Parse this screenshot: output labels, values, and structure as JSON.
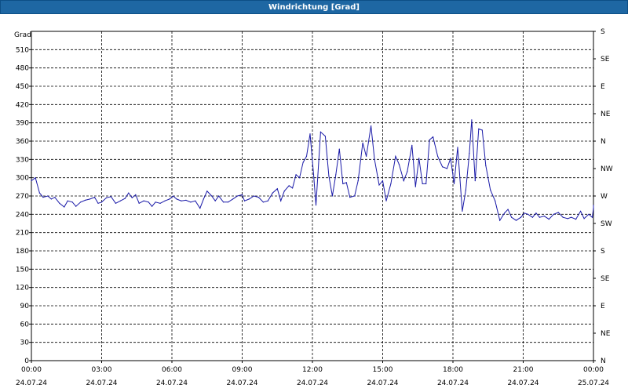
{
  "window": {
    "title": "Windrichtung [Grad]"
  },
  "chart_data": {
    "type": "line",
    "ylabel": "Grad",
    "ylim": [
      0,
      540
    ],
    "y_ticks": [
      0,
      30,
      60,
      90,
      120,
      150,
      180,
      210,
      240,
      270,
      300,
      330,
      360,
      390,
      420,
      450,
      480,
      510
    ],
    "right_axis_labels": [
      {
        "y": 0,
        "label": "N"
      },
      {
        "y": 45,
        "label": "NE"
      },
      {
        "y": 90,
        "label": "E"
      },
      {
        "y": 135,
        "label": "SE"
      },
      {
        "y": 180,
        "label": "S"
      },
      {
        "y": 225,
        "label": "SW"
      },
      {
        "y": 270,
        "label": "W"
      },
      {
        "y": 315,
        "label": "NW"
      },
      {
        "y": 360,
        "label": "N"
      },
      {
        "y": 405,
        "label": "NE"
      },
      {
        "y": 450,
        "label": "E"
      },
      {
        "y": 495,
        "label": "SE"
      },
      {
        "y": 540,
        "label": "S"
      }
    ],
    "xlim_hours": [
      0,
      24
    ],
    "x_ticks": [
      {
        "hour": 0,
        "time": "00:00",
        "date": "24.07.24"
      },
      {
        "hour": 3,
        "time": "03:00",
        "date": "24.07.24"
      },
      {
        "hour": 6,
        "time": "06:00",
        "date": "24.07.24"
      },
      {
        "hour": 9,
        "time": "09:00",
        "date": "24.07.24"
      },
      {
        "hour": 12,
        "time": "12:00",
        "date": "24.07.24"
      },
      {
        "hour": 15,
        "time": "15:00",
        "date": "24.07.24"
      },
      {
        "hour": 18,
        "time": "18:00",
        "date": "24.07.24"
      },
      {
        "hour": 21,
        "time": "21:00",
        "date": "24.07.24"
      },
      {
        "hour": 24,
        "time": "00:00",
        "date": "25.07.24"
      }
    ],
    "grid": true,
    "line_color": "#1a1aa8",
    "series": [
      {
        "points": [
          [
            0.0,
            295
          ],
          [
            0.17,
            300
          ],
          [
            0.35,
            275
          ],
          [
            0.5,
            268
          ],
          [
            0.7,
            270
          ],
          [
            0.85,
            265
          ],
          [
            1.0,
            268
          ],
          [
            1.2,
            258
          ],
          [
            1.4,
            252
          ],
          [
            1.55,
            262
          ],
          [
            1.75,
            260
          ],
          [
            1.9,
            253
          ],
          [
            2.1,
            260
          ],
          [
            2.3,
            263
          ],
          [
            2.5,
            265
          ],
          [
            2.7,
            268
          ],
          [
            2.85,
            258
          ],
          [
            3.0,
            260
          ],
          [
            3.2,
            267
          ],
          [
            3.4,
            269
          ],
          [
            3.6,
            258
          ],
          [
            3.8,
            262
          ],
          [
            4.0,
            266
          ],
          [
            4.15,
            275
          ],
          [
            4.3,
            267
          ],
          [
            4.45,
            272
          ],
          [
            4.6,
            258
          ],
          [
            4.8,
            262
          ],
          [
            5.0,
            260
          ],
          [
            5.15,
            253
          ],
          [
            5.3,
            260
          ],
          [
            5.5,
            258
          ],
          [
            5.7,
            262
          ],
          [
            5.9,
            265
          ],
          [
            6.05,
            270
          ],
          [
            6.2,
            265
          ],
          [
            6.4,
            262
          ],
          [
            6.6,
            263
          ],
          [
            6.8,
            260
          ],
          [
            7.0,
            262
          ],
          [
            7.2,
            250
          ],
          [
            7.35,
            265
          ],
          [
            7.5,
            278
          ],
          [
            7.7,
            270
          ],
          [
            7.85,
            262
          ],
          [
            8.0,
            270
          ],
          [
            8.2,
            260
          ],
          [
            8.4,
            260
          ],
          [
            8.6,
            265
          ],
          [
            8.8,
            270
          ],
          [
            9.0,
            272
          ],
          [
            9.1,
            262
          ],
          [
            9.3,
            265
          ],
          [
            9.5,
            270
          ],
          [
            9.7,
            268
          ],
          [
            9.9,
            260
          ],
          [
            10.1,
            262
          ],
          [
            10.3,
            275
          ],
          [
            10.5,
            282
          ],
          [
            10.65,
            262
          ],
          [
            10.8,
            278
          ],
          [
            11.0,
            287
          ],
          [
            11.15,
            283
          ],
          [
            11.3,
            305
          ],
          [
            11.45,
            300
          ],
          [
            11.6,
            325
          ],
          [
            11.75,
            335
          ],
          [
            11.9,
            372
          ],
          [
            12.05,
            305
          ],
          [
            12.15,
            255
          ],
          [
            12.35,
            375
          ],
          [
            12.55,
            368
          ],
          [
            12.7,
            303
          ],
          [
            12.85,
            270
          ],
          [
            13.0,
            305
          ],
          [
            13.15,
            347
          ],
          [
            13.3,
            290
          ],
          [
            13.45,
            292
          ],
          [
            13.6,
            268
          ],
          [
            13.8,
            270
          ],
          [
            13.95,
            295
          ],
          [
            14.15,
            357
          ],
          [
            14.3,
            335
          ],
          [
            14.5,
            385
          ],
          [
            14.65,
            330
          ],
          [
            14.85,
            288
          ],
          [
            15.0,
            295
          ],
          [
            15.15,
            262
          ],
          [
            15.35,
            290
          ],
          [
            15.55,
            335
          ],
          [
            15.7,
            322
          ],
          [
            15.9,
            295
          ],
          [
            16.05,
            310
          ],
          [
            16.25,
            353
          ],
          [
            16.4,
            285
          ],
          [
            16.55,
            332
          ],
          [
            16.7,
            290
          ],
          [
            16.85,
            290
          ],
          [
            17.0,
            362
          ],
          [
            17.15,
            367
          ],
          [
            17.35,
            335
          ],
          [
            17.55,
            318
          ],
          [
            17.75,
            315
          ],
          [
            17.9,
            332
          ],
          [
            18.05,
            290
          ],
          [
            18.2,
            350
          ],
          [
            18.4,
            245
          ],
          [
            18.55,
            280
          ],
          [
            18.7,
            340
          ],
          [
            18.8,
            395
          ],
          [
            18.95,
            295
          ],
          [
            19.1,
            380
          ],
          [
            19.25,
            378
          ],
          [
            19.4,
            320
          ],
          [
            19.6,
            280
          ],
          [
            19.8,
            262
          ],
          [
            20.0,
            230
          ],
          [
            20.2,
            242
          ],
          [
            20.35,
            248
          ],
          [
            20.5,
            235
          ],
          [
            20.7,
            230
          ],
          [
            20.9,
            235
          ],
          [
            21.05,
            242
          ],
          [
            21.2,
            240
          ],
          [
            21.4,
            235
          ],
          [
            21.55,
            242
          ],
          [
            21.7,
            235
          ],
          [
            21.9,
            237
          ],
          [
            22.1,
            232
          ],
          [
            22.3,
            240
          ],
          [
            22.5,
            243
          ],
          [
            22.7,
            235
          ],
          [
            22.9,
            233
          ],
          [
            23.05,
            235
          ],
          [
            23.25,
            232
          ],
          [
            23.45,
            245
          ],
          [
            23.6,
            233
          ],
          [
            23.8,
            240
          ],
          [
            23.95,
            235
          ],
          [
            24.1,
            250
          ],
          [
            24.3,
            255
          ]
        ]
      }
    ]
  }
}
